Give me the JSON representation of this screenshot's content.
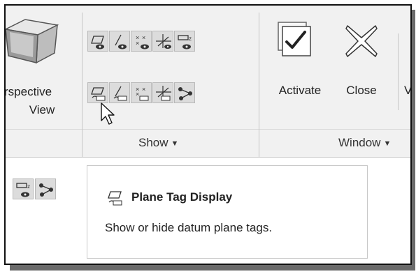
{
  "ribbon": {
    "view_group": {
      "button_label_line1": "rspective",
      "button_label_line2": "View"
    },
    "show_group": {
      "label": "Show",
      "dropdown_icon": "caret-down-icon",
      "row1_icons": [
        "plane-display-icon",
        "axis-display-icon",
        "point-display-icon",
        "csys-display-icon",
        "annotation-display-icon"
      ],
      "row2_icons": [
        "plane-tag-display-icon",
        "axis-tag-display-icon",
        "point-tag-display-icon",
        "csys-tag-display-icon",
        "spin-center-icon"
      ]
    },
    "window_group": {
      "label": "Window",
      "activate_label": "Activate",
      "close_label": "Close",
      "truncated_label": "V"
    }
  },
  "tooltip": {
    "title": "Plane Tag Display",
    "description": "Show or hide datum plane tags.",
    "icon": "plane-tag-display-icon"
  },
  "colors": {
    "ribbon_bg": "#f1f1f1",
    "button_bg": "#dcdcdc",
    "accent_red": "#c0392b"
  }
}
